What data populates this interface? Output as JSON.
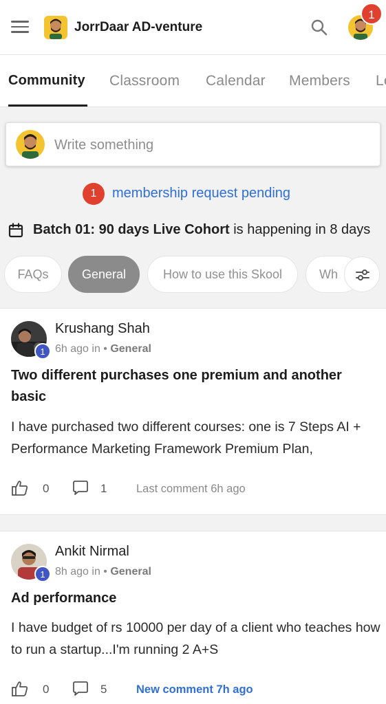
{
  "header": {
    "title": "JorrDaar AD-venture",
    "notification_count": "1",
    "icons": [
      "menu-icon",
      "search-icon"
    ]
  },
  "tabs": [
    {
      "label": "Community",
      "active": true
    },
    {
      "label": "Classroom",
      "active": false
    },
    {
      "label": "Calendar",
      "active": false
    },
    {
      "label": "Members",
      "active": false
    },
    {
      "label": "Le",
      "active": false
    }
  ],
  "composer": {
    "placeholder": "Write something"
  },
  "membership": {
    "count": "1",
    "text": "membership request pending"
  },
  "event": {
    "name": "Batch 01: 90 days Live Cohort",
    "suffix": " is happening in 8 days"
  },
  "filters": {
    "chips": [
      {
        "label": "FAQs",
        "active": false
      },
      {
        "label": "General",
        "active": true
      },
      {
        "label": "How to use this Skool",
        "active": false
      },
      {
        "label": "Wh",
        "active": false
      }
    ]
  },
  "posts": [
    {
      "author": "Krushang Shah",
      "level": "1",
      "time": "6h ago in • ",
      "category": "General",
      "title": "Two different purchases one premium and another basic",
      "body": "I have purchased two different courses: one is 7 Steps AI + Performance Marketing Framework Premium Plan,",
      "likes": "0",
      "comments": "1",
      "last_comment": "Last comment 6h ago"
    },
    {
      "author": "Ankit Nirmal",
      "level": "1",
      "time": "8h ago in • ",
      "category": "General",
      "title": "Ad performance",
      "body": "I have budget of rs 10000 per day of a client who teaches how to run a startup...I'm running 2 A+S",
      "likes": "0",
      "comments": "5",
      "last_comment": "New comment 7h ago"
    }
  ],
  "colors": {
    "accent_blue": "#2f6fd6",
    "badge_red": "#e0412f",
    "level_blue": "#3f56c4",
    "chip_active": "#8b8b8b"
  }
}
